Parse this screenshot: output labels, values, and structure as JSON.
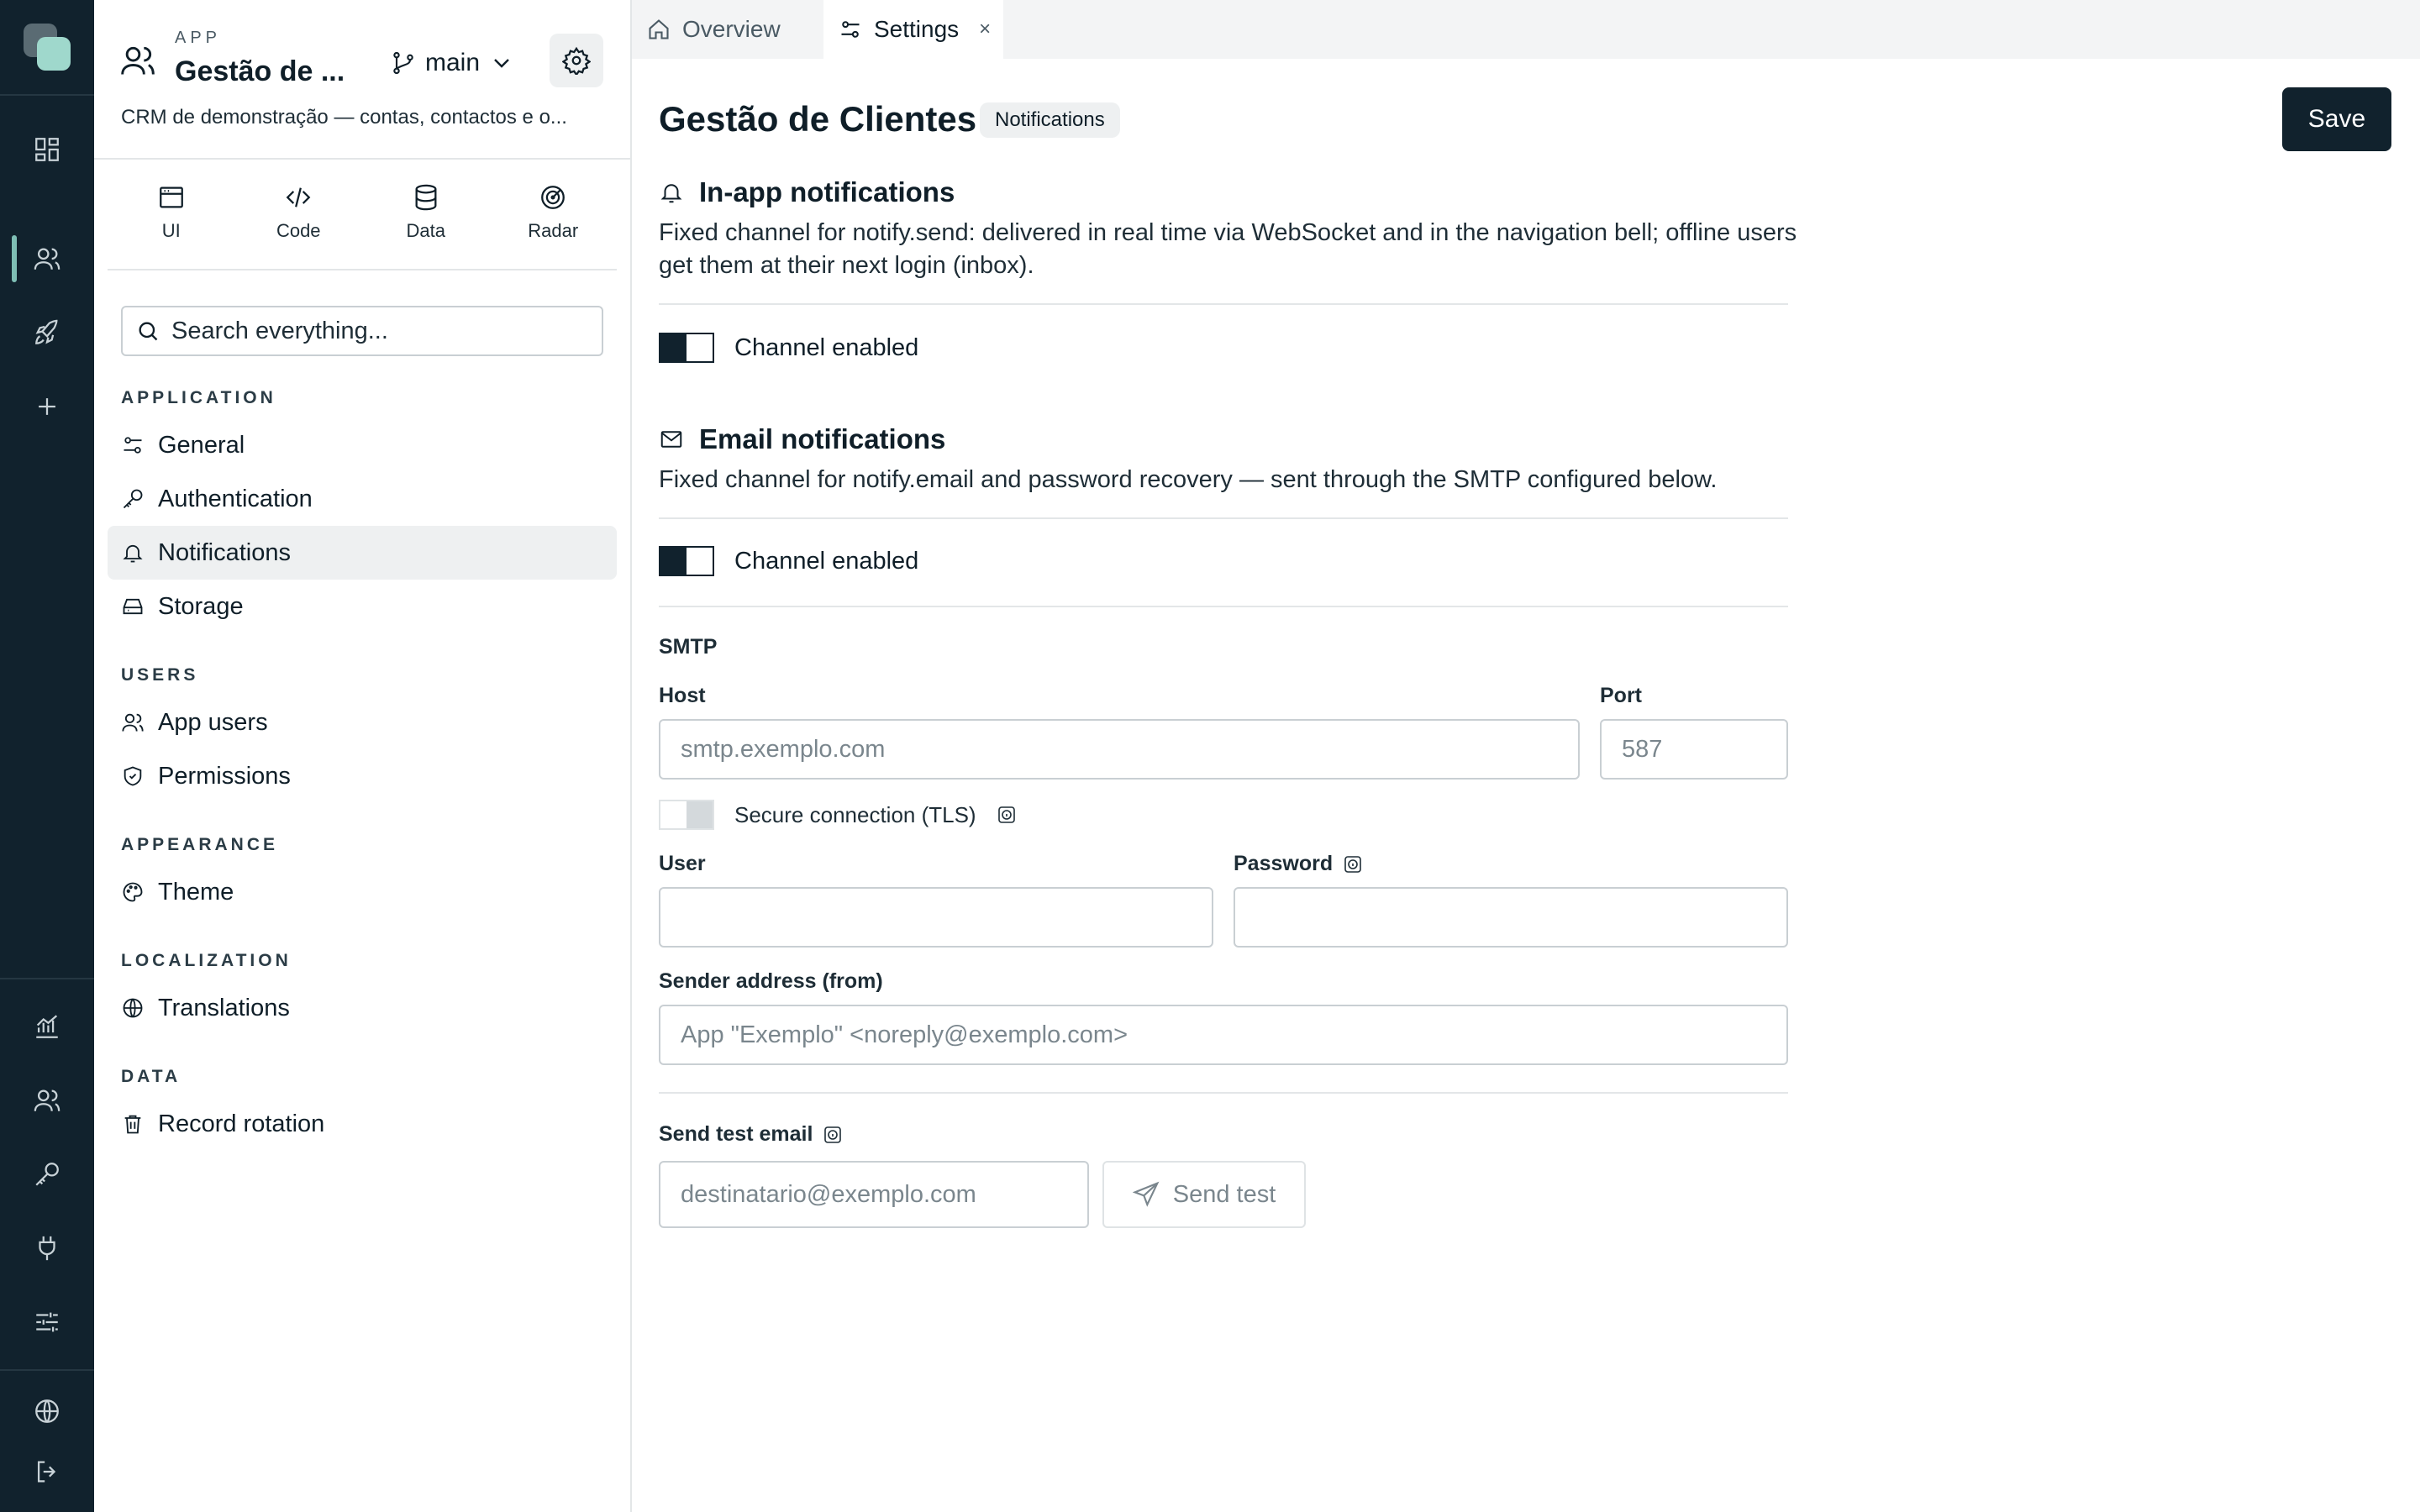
{
  "rail": {
    "icons": [
      "dashboard-icon",
      "users-icon",
      "rocket-icon",
      "plus-icon",
      "chart-icon",
      "users-icon",
      "key-icon",
      "plug-icon",
      "sliders-icon",
      "globe-icon",
      "logout-icon"
    ],
    "accent": "#7fbfb5",
    "background": "#11222d"
  },
  "app": {
    "kicker": "APP",
    "name": "Gestão de ...",
    "branch": "main",
    "description": "CRM de demonstração — contas, contactos e o..."
  },
  "mode_tabs": [
    {
      "label": "UI",
      "icon": "window-icon"
    },
    {
      "label": "Code",
      "icon": "code-icon"
    },
    {
      "label": "Data",
      "icon": "database-icon"
    },
    {
      "label": "Radar",
      "icon": "radar-icon"
    }
  ],
  "search": {
    "placeholder": "Search everything..."
  },
  "nav": {
    "application": {
      "title": "APPLICATION",
      "items": [
        {
          "label": "General",
          "icon": "sliders-icon"
        },
        {
          "label": "Authentication",
          "icon": "key-icon"
        },
        {
          "label": "Notifications",
          "icon": "bell-icon",
          "active": true
        },
        {
          "label": "Storage",
          "icon": "drive-icon"
        }
      ]
    },
    "users": {
      "title": "USERS",
      "items": [
        {
          "label": "App users",
          "icon": "users-icon"
        },
        {
          "label": "Permissions",
          "icon": "shield-icon"
        }
      ]
    },
    "appearance": {
      "title": "APPEARANCE",
      "items": [
        {
          "label": "Theme",
          "icon": "palette-icon"
        }
      ]
    },
    "localization": {
      "title": "LOCALIZATION",
      "items": [
        {
          "label": "Translations",
          "icon": "globe-icon"
        }
      ]
    },
    "data": {
      "title": "DATA",
      "items": [
        {
          "label": "Record rotation",
          "icon": "trash-icon"
        }
      ]
    }
  },
  "tabs": [
    {
      "label": "Overview",
      "icon": "home-icon",
      "active": false
    },
    {
      "label": "Settings",
      "icon": "sliders-icon",
      "active": true,
      "close": "×"
    }
  ],
  "page": {
    "title": "Gestão de Clientes",
    "badge": "Notifications",
    "save_label": "Save"
  },
  "inapp": {
    "title": "In-app notifications",
    "description": "Fixed channel for notify.send: delivered in real time via WebSocket and in the navigation bell; offline users get them at their next login (inbox).",
    "toggle_label": "Channel enabled",
    "enabled": true
  },
  "email": {
    "title": "Email notifications",
    "description": "Fixed channel for notify.email and password recovery — sent through the SMTP configured below.",
    "toggle_label": "Channel enabled",
    "enabled": true
  },
  "smtp": {
    "title": "SMTP",
    "host_label": "Host",
    "host_placeholder": "smtp.exemplo.com",
    "host_value": "",
    "port_label": "Port",
    "port_placeholder": "587",
    "tls_label": "Secure connection (TLS)",
    "tls_enabled": false,
    "user_label": "User",
    "user_value": "",
    "password_label": "Password",
    "password_value": "",
    "from_label": "Sender address (from)",
    "from_placeholder": "App \"Exemplo\" <noreply@exemplo.com>"
  },
  "test": {
    "label": "Send test email",
    "placeholder": "destinatario@exemplo.com",
    "button": "Send test"
  }
}
